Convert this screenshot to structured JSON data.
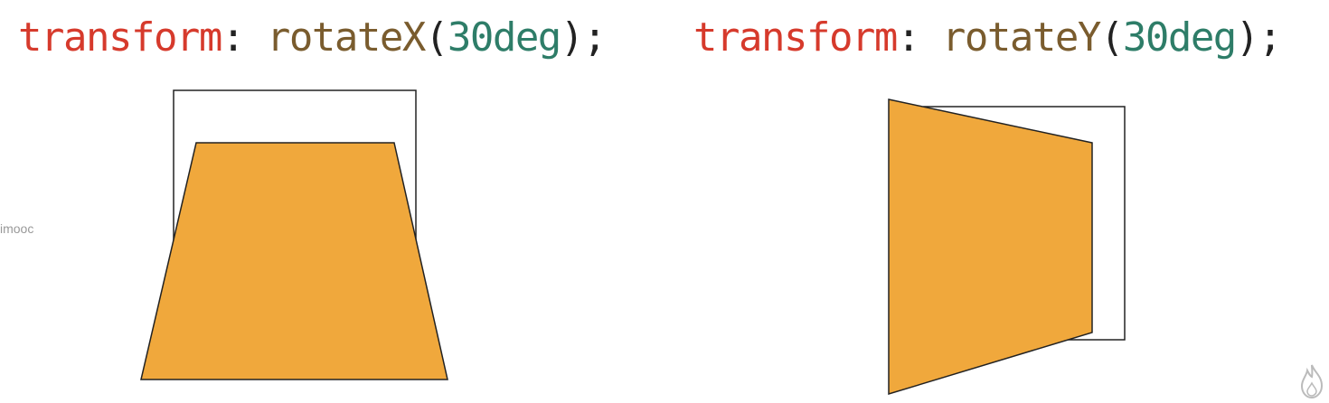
{
  "examples": [
    {
      "property": "transform",
      "colon": ": ",
      "function": "rotateX",
      "open": "(",
      "argument": "30deg",
      "close": ");"
    },
    {
      "property": "transform",
      "colon": ": ",
      "function": "rotateY",
      "open": "(",
      "argument": "30deg",
      "close": ");"
    }
  ],
  "watermark": "imooc",
  "colors": {
    "property": "#d63a2c",
    "function": "#7a5c2e",
    "argument": "#2e7d68",
    "shape_fill": "#f0a83c",
    "outline": "#222222"
  },
  "icons": {
    "corner_logo": "flame-icon"
  }
}
